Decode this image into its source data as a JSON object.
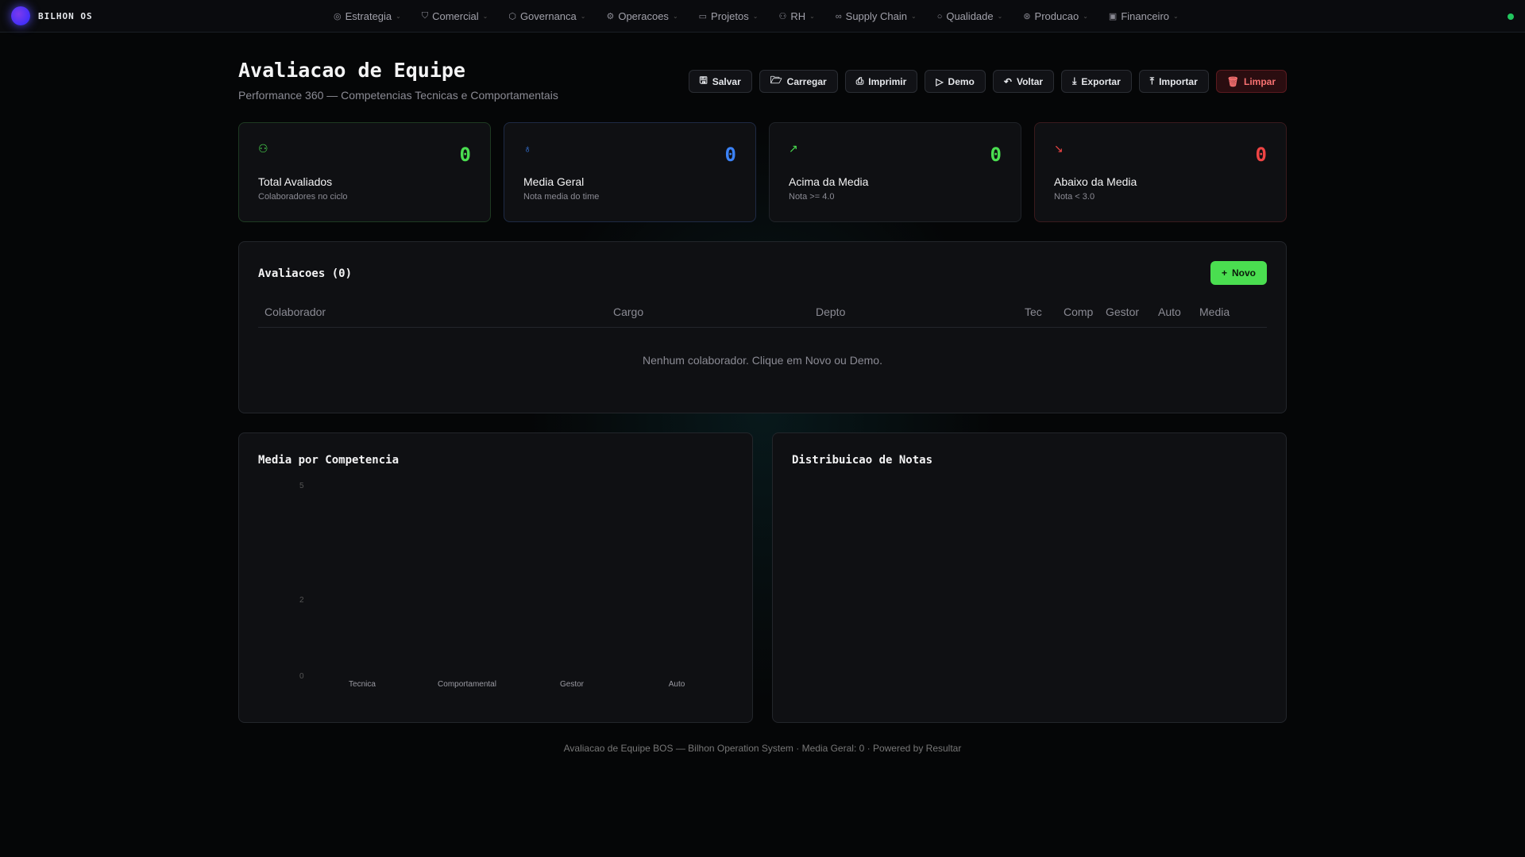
{
  "brand": "BILHON OS",
  "nav": [
    {
      "label": "Estrategia",
      "icon": "compass-icon",
      "glyph": "◎"
    },
    {
      "label": "Comercial",
      "icon": "handshake-icon",
      "glyph": "⛉"
    },
    {
      "label": "Governanca",
      "icon": "shield-icon",
      "glyph": "⬡"
    },
    {
      "label": "Operacoes",
      "icon": "gear-icon",
      "glyph": "⚙"
    },
    {
      "label": "Projetos",
      "icon": "folder-icon",
      "glyph": "▭"
    },
    {
      "label": "RH",
      "icon": "users-icon",
      "glyph": "⚇"
    },
    {
      "label": "Supply Chain",
      "icon": "link-icon",
      "glyph": "∞"
    },
    {
      "label": "Qualidade",
      "icon": "search-icon",
      "glyph": "○"
    },
    {
      "label": "Producao",
      "icon": "factory-icon",
      "glyph": "⊛"
    },
    {
      "label": "Financeiro",
      "icon": "wallet-icon",
      "glyph": "▣"
    }
  ],
  "header": {
    "title": "Avaliacao de Equipe",
    "subtitle": "Performance 360 — Competencias Tecnicas e Comportamentais"
  },
  "toolbar": [
    {
      "label": "Salvar",
      "icon": "save-icon",
      "glyph": "🖫"
    },
    {
      "label": "Carregar",
      "icon": "folder-open-icon",
      "glyph": "🗁"
    },
    {
      "label": "Imprimir",
      "icon": "printer-icon",
      "glyph": "⎙"
    },
    {
      "label": "Demo",
      "icon": "play-icon",
      "glyph": "▷"
    },
    {
      "label": "Voltar",
      "icon": "undo-icon",
      "glyph": "↶"
    },
    {
      "label": "Exportar",
      "icon": "download-icon",
      "glyph": "⤓"
    },
    {
      "label": "Importar",
      "icon": "upload-icon",
      "glyph": "⤒"
    },
    {
      "label": "Limpar",
      "icon": "trash-icon",
      "glyph": "🗑"
    }
  ],
  "stats": [
    {
      "label": "Total Avaliados",
      "desc": "Colaboradores no ciclo",
      "value": "0",
      "color": "#4ade50",
      "border": "#1e3a22",
      "glyph": "⚇"
    },
    {
      "label": "Media Geral",
      "desc": "Nota media do time",
      "value": "0",
      "color": "#3b82f6",
      "border": "#1e2a44",
      "glyph": "♁"
    },
    {
      "label": "Acima da Media",
      "desc": "Nota >= 4.0",
      "value": "0",
      "color": "#4ade50",
      "border": "#1f2328",
      "glyph": "↗"
    },
    {
      "label": "Abaixo da Media",
      "desc": "Nota < 3.0",
      "value": "0",
      "color": "#ef4444",
      "border": "#3a1a1d",
      "glyph": "↘"
    }
  ],
  "table": {
    "title": "Avaliacoes (0)",
    "new_label": "Novo",
    "columns": [
      "Colaborador",
      "Cargo",
      "Depto",
      "Tec",
      "Comp",
      "Gestor",
      "Auto",
      "Media"
    ],
    "empty": "Nenhum colaborador. Clique em Novo ou Demo."
  },
  "chart_data": [
    {
      "type": "bar",
      "title": "Media por Competencia",
      "categories": [
        "Tecnica",
        "Comportamental",
        "Gestor",
        "Auto"
      ],
      "values": [],
      "yticks": [
        "5",
        "2",
        "0"
      ],
      "ylim": [
        0,
        5
      ]
    },
    {
      "type": "pie",
      "title": "Distribuicao de Notas",
      "categories": [],
      "values": []
    }
  ],
  "footer": "Avaliacao de Equipe BOS — Bilhon Operation System · Media Geral: 0 · Powered by Resultar"
}
